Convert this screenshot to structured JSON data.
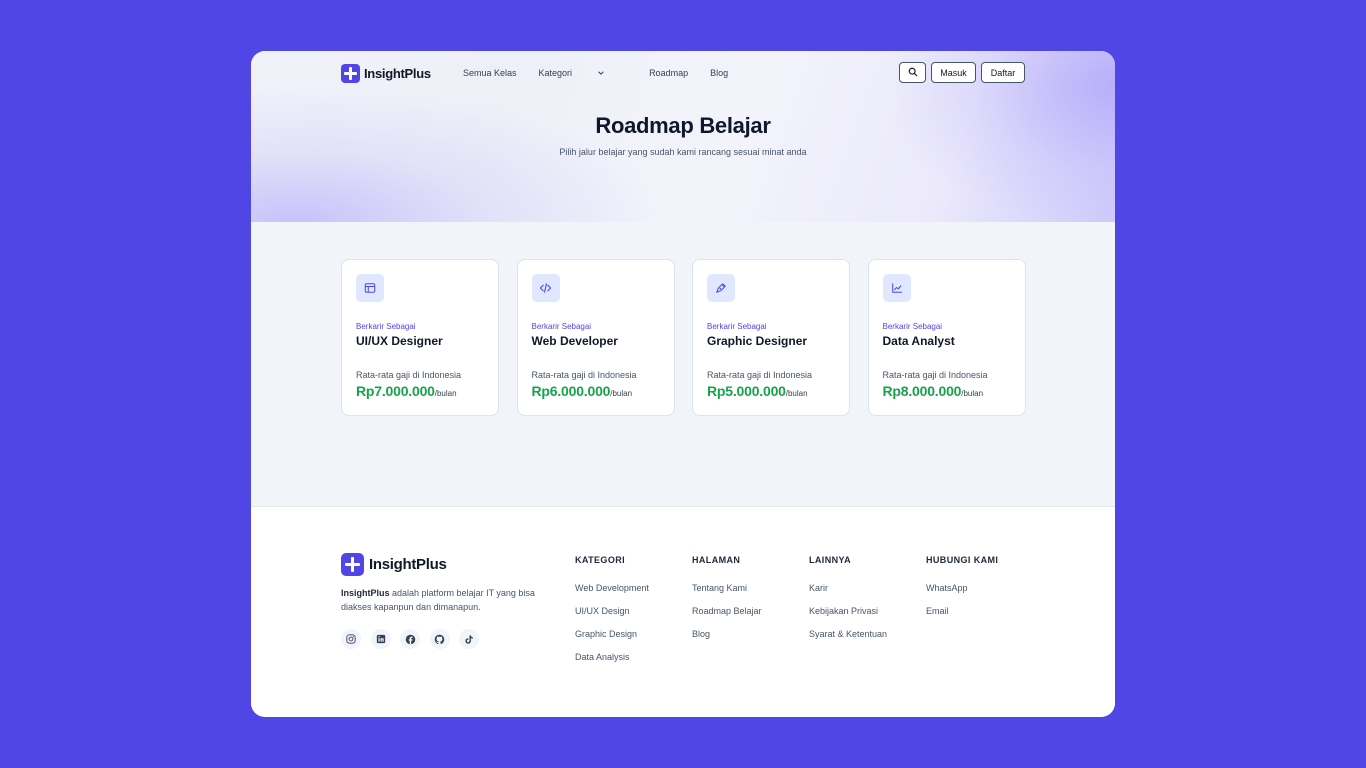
{
  "brand": {
    "name": "InsightPlus",
    "accent": "#4f46e5"
  },
  "nav": {
    "links": [
      "Semua Kelas",
      "Kategori",
      "Roadmap",
      "Blog"
    ],
    "login": "Masuk",
    "register": "Daftar"
  },
  "hero": {
    "title": "Roadmap Belajar",
    "subtitle": "Pilih jalur belajar yang sudah kami rancang sesuai minat anda"
  },
  "roadmaps": [
    {
      "kicker": "Berkarir Sebagai",
      "title": "UI/UX Designer",
      "salary_label": "Rata-rata gaji di Indonesia",
      "amount": "Rp7.000.000",
      "unit": "/bulan",
      "icon": "layout-icon"
    },
    {
      "kicker": "Berkarir Sebagai",
      "title": "Web Developer",
      "salary_label": "Rata-rata gaji di Indonesia",
      "amount": "Rp6.000.000",
      "unit": "/bulan",
      "icon": "code-icon"
    },
    {
      "kicker": "Berkarir Sebagai",
      "title": "Graphic Designer",
      "salary_label": "Rata-rata gaji di Indonesia",
      "amount": "Rp5.000.000",
      "unit": "/bulan",
      "icon": "pen-tool-icon"
    },
    {
      "kicker": "Berkarir Sebagai",
      "title": "Data Analyst",
      "salary_label": "Rata-rata gaji di Indonesia",
      "amount": "Rp8.000.000",
      "unit": "/bulan",
      "icon": "chart-line-icon"
    }
  ],
  "footer": {
    "desc_brand": "InsightPlus",
    "desc_rest": " adalah platform belajar IT yang bisa diakses kapanpun dan dimanapun.",
    "socials": [
      "instagram-icon",
      "linkedin-icon",
      "facebook-icon",
      "github-icon",
      "tiktok-icon"
    ],
    "columns": [
      {
        "title": "KATEGORI",
        "items": [
          "Web Development",
          "UI/UX Design",
          "Graphic Design",
          "Data Analysis"
        ]
      },
      {
        "title": "HALAMAN",
        "items": [
          "Tentang Kami",
          "Roadmap Belajar",
          "Blog"
        ]
      },
      {
        "title": "LAINNYA",
        "items": [
          "Karir",
          "Kebijakan Privasi",
          "Syarat & Ketentuan"
        ]
      },
      {
        "title": "HUBUNGI KAMI",
        "items": [
          "WhatsApp",
          "Email"
        ]
      }
    ]
  }
}
